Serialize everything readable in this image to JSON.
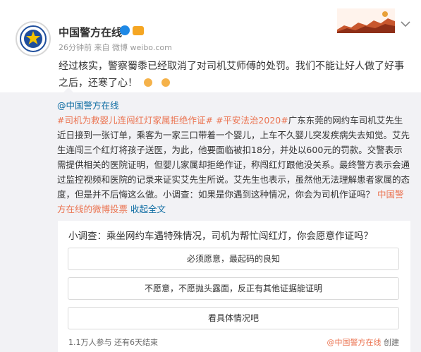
{
  "post": {
    "author": "中国警方在线",
    "time_ago": "26分钟前",
    "source_prefix": "来自",
    "source": "微博 weibo.com",
    "text": "经过核实，警察蜀黍已经取消了对司机艾师傅的处罚。我们不能让好人做了好事之后，还寒了心！"
  },
  "repost": {
    "mention": "@中国警方在线",
    "tag1": "#司机为救婴儿连闯红灯家属拒绝作证#",
    "tag2": "#平安法治2020#",
    "body": "广东东莞的网约车司机艾先生近日接到一张订单，乘客为一家三口带着一个婴儿，上车不久婴儿突发疾病失去知觉。艾先生连闯三个红灯将孩子送医，为此，他要面临被扣18分，并处以600元的罚款。交警表示需提供相关的医院证明，但婴儿家属却拒绝作证，称闯红灯跟他没关系。最终警方表示会通过监控视频和医院的记录来证实艾先生所说。艾先生也表示，虽然他无法理解患者家属的态度，但是并不后悔这么做。小调查：如果是你遇到这种情况，你会为司机作证吗？",
    "link_text": "中国警方在线的微博投票",
    "collapse": "收起全文"
  },
  "poll": {
    "title": "小调查：乘坐网约车遇特殊情况，司机为帮忙闯红灯，你会愿意作证吗？",
    "options": [
      "必须愿意，最起码的良知",
      "不愿意，不愿抛头露面，反正有其他证据能证明",
      "看具体情况吧"
    ],
    "stats": "1.1万人参与 还有6天结束",
    "creator": "@中国警方在线",
    "create_label": "创建"
  }
}
